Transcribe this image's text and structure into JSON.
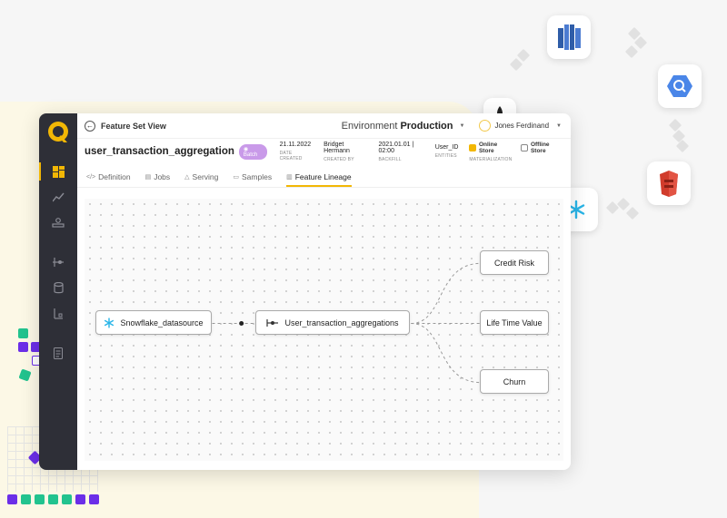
{
  "window": {
    "view_title": "Feature Set View",
    "environment_label": "Environment",
    "environment_value": "Production",
    "user_name": "Jones Ferdinand"
  },
  "feature_set": {
    "name": "user_transaction_aggregation",
    "badge": "Batch",
    "meta": [
      {
        "value": "21.11.2022",
        "label": "DATE CREATED"
      },
      {
        "value": "Bridget Hermann",
        "label": "CREATED BY"
      },
      {
        "value": "2021.01.01 | 02:00",
        "label": "BACKFILL"
      },
      {
        "value": "User_ID",
        "label": "ENTITIES"
      }
    ],
    "online_store": "Online Store",
    "offline_store": "Offline Store",
    "materialization_label": "MATERIALIZATION"
  },
  "tabs": [
    "Definition",
    "Jobs",
    "Serving",
    "Samples",
    "Feature Lineage"
  ],
  "active_tab": "Feature Lineage",
  "lineage": {
    "source": "Snowflake_datasource",
    "featureset": "User_transaction_aggregations",
    "outputs": [
      "Credit Risk",
      "Life Time Value",
      "Churn"
    ]
  },
  "colors": {
    "accent": "#f2b705",
    "sidebar": "#2e2f37",
    "badge": "#c99ae9",
    "cream": "#fcf8e6",
    "green": "#22c38e",
    "purple": "#6b2ee8"
  },
  "icons": {
    "float": [
      "redshift-icon",
      "bigquery-icon",
      "s3-icon",
      "snowflake-icon",
      "mongodb-icon"
    ],
    "sidebar": [
      "dashboard-icon",
      "analytics-icon",
      "entities-icon",
      "pipeline-icon",
      "database-icon",
      "lineage-icon",
      "document-icon"
    ]
  }
}
